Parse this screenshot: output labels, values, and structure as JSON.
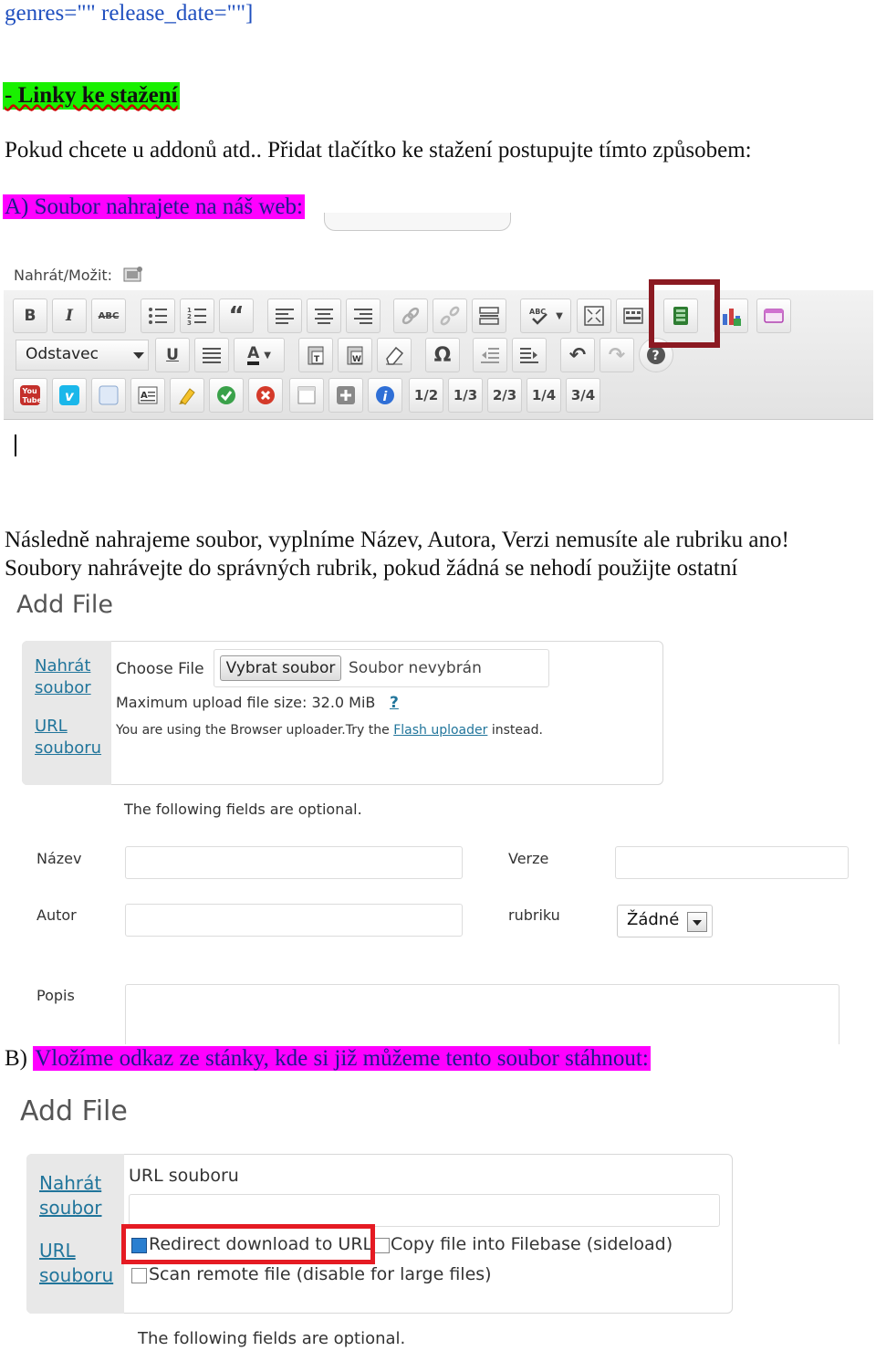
{
  "code_line": "genres=\"\" release_date=\"\"]",
  "links_heading": "- Linky ke stažení",
  "intro": "Pokud chcete u addonů atd.. Přidat tlačítko ke stažení postupujte tímto způsobem:",
  "step_a": "A) Soubor nahrajete na náš web:",
  "editor": {
    "upload_label": "Nahrát/Možit:",
    "format_select": "Odstavec",
    "column_buttons": [
      "1/2",
      "1/3",
      "2/3",
      "1/4",
      "3/4"
    ],
    "youtube_label": "You Tube",
    "vimeo_label": "v"
  },
  "para_next": "Následně nahrajeme soubor, vyplníme Název, Autora, Verzi nemusíte ale rubriku ano!",
  "para_rubrics": "Soubory nahrávejte do správných rubrik, pokud žádná se nehodí použijte ostatní",
  "add_file_1": {
    "title": "Add File",
    "side_links": [
      "Nahrát soubor",
      "URL souboru"
    ],
    "choose_file_label": "Choose File",
    "choose_button": "Vybrat soubor",
    "no_file": "Soubor nevybrán",
    "max_size": "Maximum upload file size: 32.0 MiB",
    "help": "?",
    "uploader_prefix": "You are using the Browser uploader.Try the",
    "flash_link": "Flash uploader",
    "uploader_suffix": "instead.",
    "optional_note": "The following fields are optional.",
    "fields": {
      "name": "Název",
      "version": "Verze",
      "author": "Autor",
      "rubric": "rubriku",
      "description": "Popis"
    },
    "rubric_value": "Žádné"
  },
  "step_b_prefix": "B) ",
  "step_b": "Vložíme odkaz ze stánky, kde si již můžeme tento soubor stáhnout:",
  "add_file_2": {
    "title": "Add File",
    "side_links": [
      "Nahrát soubor",
      "URL souboru"
    ],
    "url_label": "URL souboru",
    "redirect_option": "Redirect download to URL",
    "redirect_checked": true,
    "copy_option": "Copy file into Filebase (sideload)",
    "scan_option": "Scan remote file (disable for large files)",
    "optional_note": "The following fields are optional."
  },
  "colors": {
    "heading_highlight": "#19f000",
    "step_highlight": "#ff00ff",
    "link": "#21759b",
    "box_dark_red": "#8b1a22",
    "box_red": "#e51b23"
  }
}
